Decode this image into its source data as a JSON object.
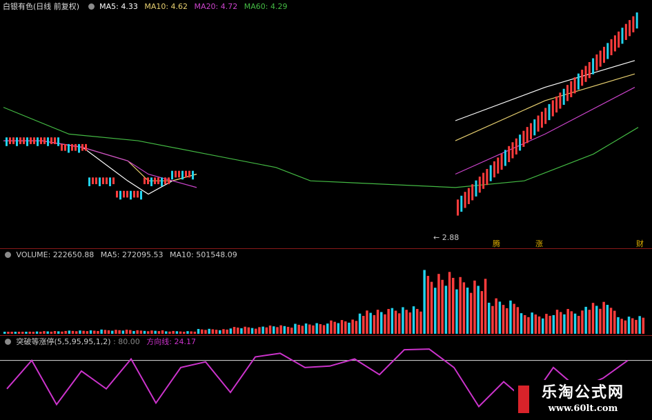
{
  "price_panel": {
    "stock_name": "白银有色",
    "mode": "(日线 前复权)",
    "ma5_label": "MA5:",
    "ma5_value": "4.33",
    "ma10_label": "MA10:",
    "ma10_value": "4.62",
    "ma20_label": "MA20:",
    "ma20_value": "4.72",
    "ma60_label": "MA60:",
    "ma60_value": "4.29",
    "low_annotation": "2.88",
    "tags": [
      "腾",
      "涨",
      "财"
    ]
  },
  "volume_panel": {
    "label": "VOLUME:",
    "value": "222650.88",
    "ma5_label": "MA5:",
    "ma5_value": "272095.53",
    "ma10_label": "MA10:",
    "ma10_value": "501548.09"
  },
  "indicator_panel": {
    "name": "突破等涨停(5,5,95,95,1,2)",
    "level_value": ": 80.00",
    "line_label": "方向线:",
    "line_value": "24.17"
  },
  "watermark": {
    "name": "乐淘公式网",
    "url": "www.60lt.com"
  },
  "colors": {
    "ma5": "#ffffff",
    "ma10": "#e8d070",
    "ma20": "#cc44cc",
    "ma60": "#44bb44",
    "up": "#ff3c3c",
    "down": "#22d3ee",
    "indicator": "#cc33cc"
  },
  "chart_data": [
    {
      "type": "line",
      "title": "白银有色 (日线 前复权)",
      "series": [
        {
          "name": "MA5",
          "values": [
            4.1,
            4.1,
            4.0,
            3.5,
            3.3,
            3.5,
            3.6,
            4.4,
            4.9,
            5.3
          ]
        },
        {
          "name": "MA10",
          "values": [
            4.1,
            4.1,
            4.0,
            3.8,
            3.5,
            3.5,
            3.6,
            4.1,
            4.7,
            5.1
          ]
        },
        {
          "name": "MA20",
          "values": [
            4.1,
            4.1,
            4.0,
            3.8,
            3.6,
            3.5,
            3.4,
            3.6,
            4.2,
            4.9
          ]
        },
        {
          "name": "MA60",
          "values": [
            4.6,
            4.2,
            4.1,
            3.9,
            3.7,
            3.5,
            3.4,
            3.5,
            3.9,
            4.3
          ]
        }
      ],
      "annotations": [
        {
          "text": "2.88",
          "meaning": "low"
        }
      ]
    },
    {
      "type": "bar",
      "title": "VOLUME",
      "series": [
        {
          "name": "VOLUME",
          "values": [
            0.03,
            0.04,
            0.05,
            0.06,
            0.05,
            0.04,
            0.07,
            0.1,
            0.12,
            0.15,
            0.2,
            0.35,
            0.4,
            0.9,
            0.8,
            0.5,
            0.3,
            0.35,
            0.45,
            0.25
          ]
        }
      ]
    },
    {
      "type": "line",
      "title": "突破等涨停(5,5,95,95,1,2)",
      "series": [
        {
          "name": "方向线",
          "values": [
            40,
            80,
            18,
            65,
            40,
            82,
            20,
            70,
            78,
            35,
            85,
            90,
            70,
            72,
            82,
            60,
            95,
            96,
            70,
            15,
            50,
            20,
            70,
            40,
            55,
            80
          ]
        }
      ],
      "reference_line": 80
    }
  ]
}
